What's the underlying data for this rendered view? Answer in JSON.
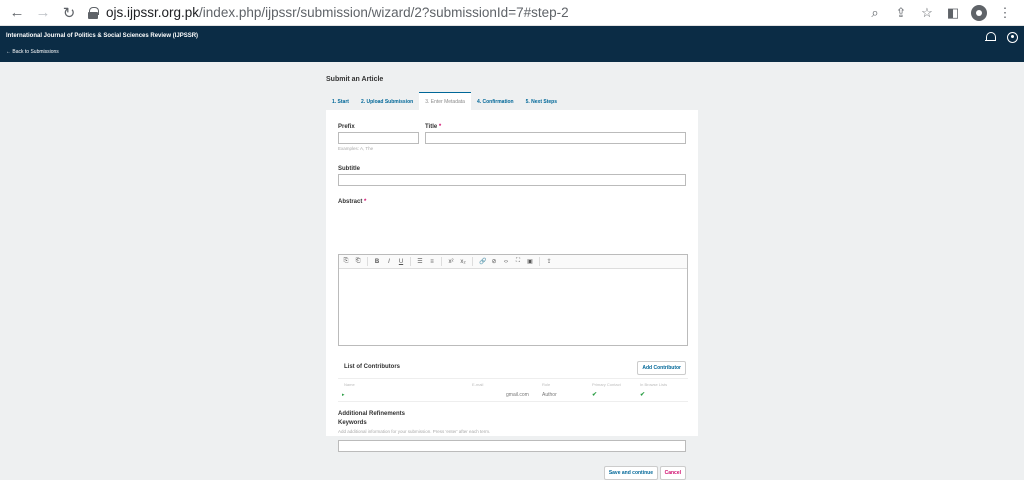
{
  "browser": {
    "url_host": "ojs.ijpssr.org.pk",
    "url_path": "/index.php/ijpssr/submission/wizard/2?submissionId=7#step-2"
  },
  "header": {
    "journal_title": "International Journal of Politics & Social Sciences Review (IJPSSR)",
    "back_link": "← Back to Submissions"
  },
  "page": {
    "heading": "Submit an Article",
    "steps": [
      {
        "label": "1. Start"
      },
      {
        "label": "2. Upload Submission"
      },
      {
        "label": "3. Enter Metadata"
      },
      {
        "label": "4. Confirmation"
      },
      {
        "label": "5. Next Steps"
      }
    ]
  },
  "form": {
    "prefix_label": "Prefix",
    "prefix_help": "Examples: A, The",
    "title_label": "Title",
    "required_mark": "*",
    "subtitle_label": "Subtitle",
    "abstract_label": "Abstract",
    "toolbar_icons": [
      "copy-icon",
      "paste-icon",
      "bold-icon",
      "italic-icon",
      "underline-icon",
      "bullet-list-icon",
      "numbered-list-icon",
      "superscript-icon",
      "subscript-icon",
      "link-icon",
      "unlink-icon",
      "code-icon",
      "fullscreen-icon",
      "image-icon",
      "upload-icon"
    ],
    "toolbar_glyphs": [
      "⎘",
      "⎗",
      "B",
      "I",
      "U",
      "☰",
      "≡",
      "x²",
      "x₂",
      "🔗",
      "⊘",
      "‹›",
      "⛶",
      "▣",
      "⇪"
    ]
  },
  "contributors": {
    "title": "List of Contributors",
    "add_button": "Add Contributor",
    "columns": [
      "Name",
      "E-mail",
      "Role",
      "Primary Contact",
      "In Browse Lists"
    ],
    "rows": [
      {
        "name": "▸",
        "email": "gmail.com",
        "role": "Author",
        "primary": "✔",
        "browse": "✔"
      }
    ]
  },
  "refinements": {
    "heading": "Additional Refinements",
    "keywords_label": "Keywords",
    "keywords_help": "Add additional information for your submission. Press 'enter' after each term."
  },
  "actions": {
    "save": "Save and continue",
    "cancel": "Cancel"
  }
}
